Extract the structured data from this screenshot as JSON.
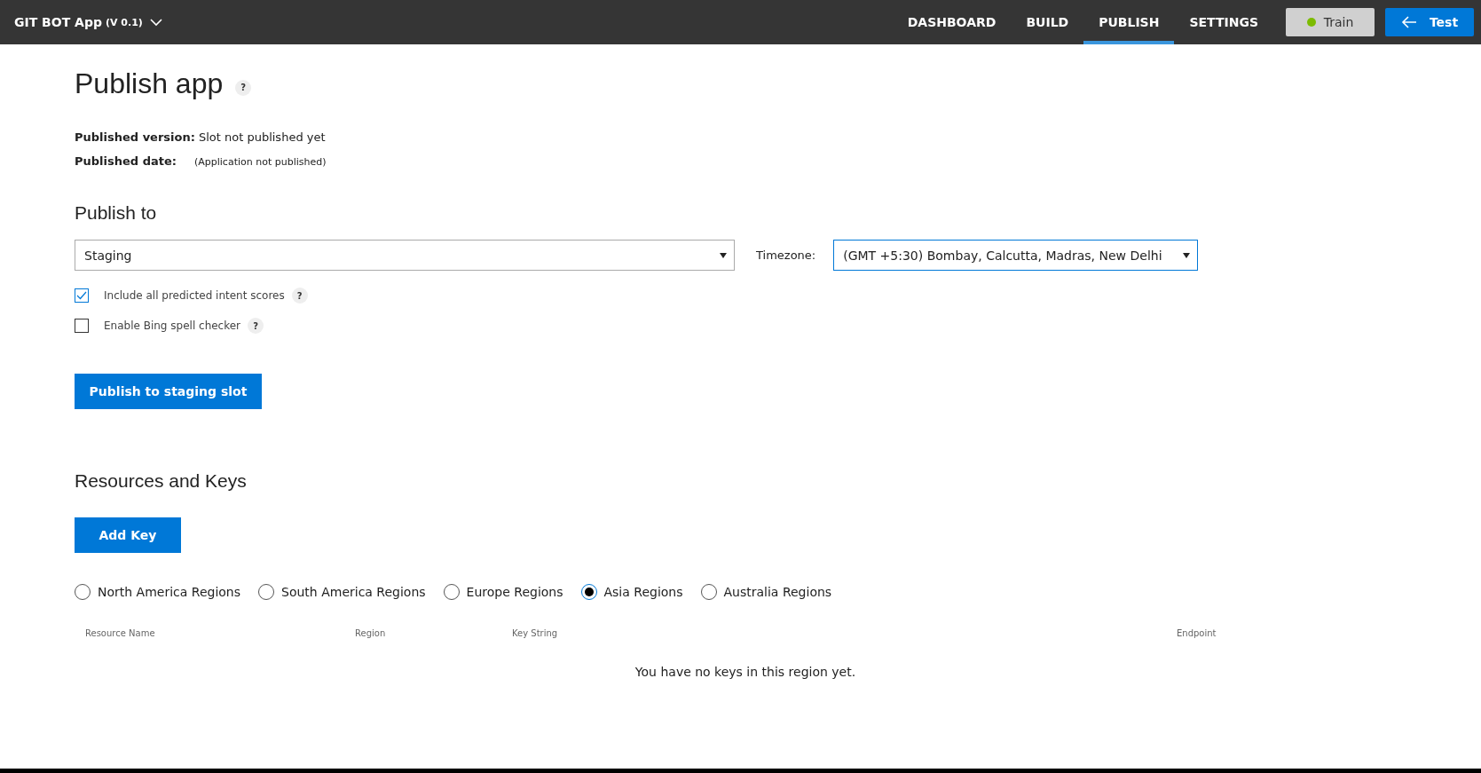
{
  "app": {
    "name": "GIT BOT App",
    "version": "(V 0.1)"
  },
  "nav": [
    {
      "label": "DASHBOARD",
      "selected": false
    },
    {
      "label": "BUILD",
      "selected": false
    },
    {
      "label": "PUBLISH",
      "selected": true
    },
    {
      "label": "SETTINGS",
      "selected": false
    }
  ],
  "train_button": {
    "label": "Train"
  },
  "test_button": {
    "label": "Test"
  },
  "page": {
    "title": "Publish app",
    "help": "?"
  },
  "published_version": {
    "label": "Published version:",
    "value": "Slot not published yet"
  },
  "published_date": {
    "label": "Published date:",
    "value": "(Application not published)"
  },
  "publish_to": {
    "heading": "Publish to",
    "slot": "Staging",
    "timezone_label": "Timezone:",
    "timezone": "(GMT +5:30) Bombay, Calcutta, Madras, New Delhi"
  },
  "options": [
    {
      "label": "Include all predicted intent scores",
      "checked": true,
      "help": "?"
    },
    {
      "label": "Enable Bing spell checker",
      "checked": false,
      "help": "?"
    }
  ],
  "publish_button": {
    "label": "Publish to staging slot"
  },
  "resources": {
    "heading": "Resources and Keys",
    "add_button": "Add Key"
  },
  "regions": [
    {
      "label": "North America Regions",
      "selected": false
    },
    {
      "label": "South America Regions",
      "selected": false
    },
    {
      "label": "Europe Regions",
      "selected": false
    },
    {
      "label": "Asia Regions",
      "selected": true
    },
    {
      "label": "Australia Regions",
      "selected": false
    }
  ],
  "table": {
    "columns": [
      "Resource Name",
      "Region",
      "Key String",
      "Endpoint"
    ],
    "empty_message": "You have no keys in this region yet."
  }
}
